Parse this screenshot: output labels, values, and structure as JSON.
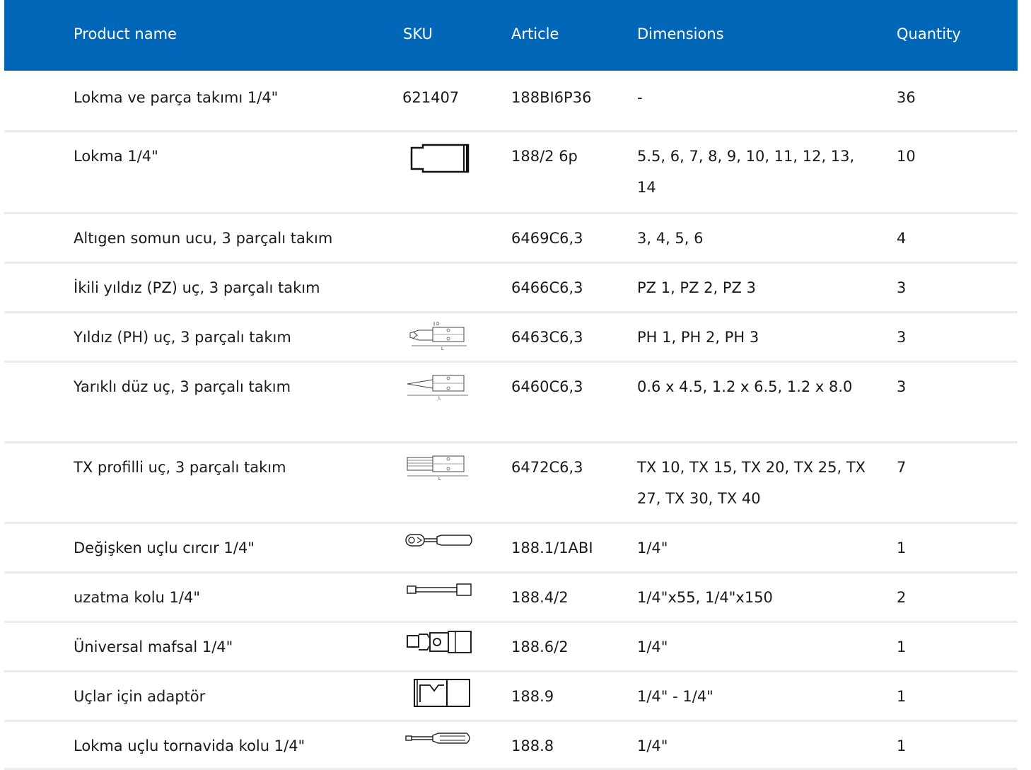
{
  "table": {
    "headers": {
      "product_name": "Product name",
      "sku": "SKU",
      "article": "Article",
      "dimensions": "Dimensions",
      "quantity": "Quantity"
    },
    "rows": [
      {
        "name": "Lokma ve parça takımı 1/4\"",
        "sku": "621407",
        "article": "188BI6P36",
        "dimensions": "-",
        "quantity": "36",
        "icon": ""
      },
      {
        "name": "Lokma 1/4\"",
        "sku": "",
        "article": "188/2 6p",
        "dimensions": "5.5, 6, 7, 8, 9, 10, 11, 12, 13, 14",
        "quantity": "10",
        "icon": "socket-icon"
      },
      {
        "name": "Altıgen somun ucu, 3 parçalı takım",
        "sku": "",
        "article": "6469C6,3",
        "dimensions": "3, 4, 5, 6",
        "quantity": "4",
        "icon": ""
      },
      {
        "name": "İkili yıldız (PZ) uç, 3 parçalı takım",
        "sku": "",
        "article": "6466C6,3",
        "dimensions": "PZ 1, PZ 2, PZ 3",
        "quantity": "3",
        "icon": ""
      },
      {
        "name": "Yıldız (PH) uç, 3 parçalı takım",
        "sku": "",
        "article": "6463C6,3",
        "dimensions": "PH 1, PH 2, PH 3",
        "quantity": "3",
        "icon": "phillips-bit-icon"
      },
      {
        "name": "Yarıklı düz uç, 3 parçalı takım",
        "sku": "",
        "article": "6460C6,3",
        "dimensions": "0.6 x 4.5, 1.2 x 6.5, 1.2 x 8.0",
        "quantity": "3",
        "icon": "slotted-bit-icon"
      },
      {
        "name": "TX profilli uç, 3 parçalı takım",
        "sku": "",
        "article": "6472C6,3",
        "dimensions": "TX 10, TX 15, TX 20, TX 25, TX 27, TX 30, TX 40",
        "quantity": "7",
        "icon": "torx-bit-icon"
      },
      {
        "name": "Değişken uçlu cırcır 1/4\"",
        "sku": "",
        "article": "188.1/1ABI",
        "dimensions": "1/4\"",
        "quantity": "1",
        "icon": "ratchet-icon"
      },
      {
        "name": "uzatma kolu 1/4\"",
        "sku": "",
        "article": "188.4/2",
        "dimensions": "1/4\"x55, 1/4\"x150",
        "quantity": "2",
        "icon": "extension-bar-icon"
      },
      {
        "name": "Üniversal mafsal 1/4\"",
        "sku": "",
        "article": "188.6/2",
        "dimensions": "1/4\"",
        "quantity": "1",
        "icon": "universal-joint-icon"
      },
      {
        "name": "Uçlar için adaptör",
        "sku": "",
        "article": "188.9",
        "dimensions": "1/4\" - 1/4\"",
        "quantity": "1",
        "icon": "bit-adapter-icon"
      },
      {
        "name": "Lokma uçlu tornavida kolu 1/4\"",
        "sku": "",
        "article": "188.8",
        "dimensions": "1/4\"",
        "quantity": "1",
        "icon": "screwdriver-handle-icon"
      }
    ]
  },
  "colors": {
    "header_bg": "#0067b8",
    "header_text": "#ffffff",
    "row_divider": "#ececec"
  }
}
